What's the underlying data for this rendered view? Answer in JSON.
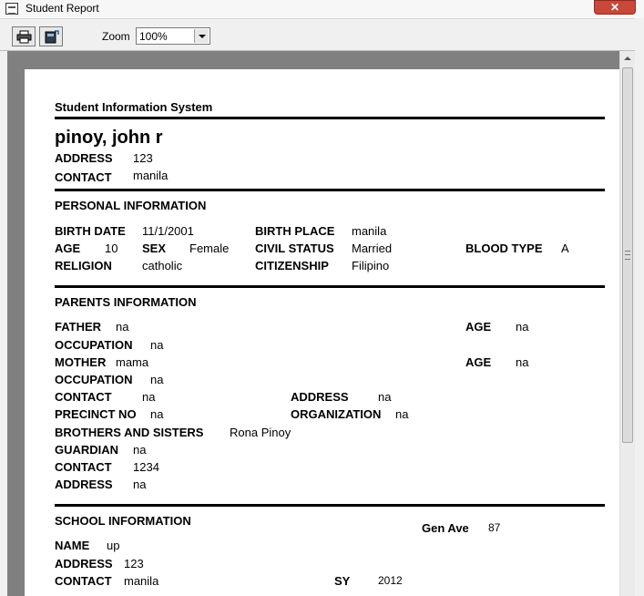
{
  "window": {
    "title": "Student Report",
    "close_glyph": "✕"
  },
  "toolbar": {
    "print_icon": "printer-icon",
    "export_icon": "export-icon",
    "zoom_label": "Zoom",
    "zoom_value": "100%"
  },
  "report": {
    "header": "Student Information System",
    "student_name": "pinoy, john r",
    "address_label": "ADDRESS",
    "address": "123",
    "contact_label": "CONTACT",
    "contact": "manila",
    "personal": {
      "title": "PERSONAL INFORMATION",
      "birth_date_label": "BIRTH DATE",
      "birth_date": "11/1/2001",
      "birth_place_label": "BIRTH PLACE",
      "birth_place": "manila",
      "age_label": "AGE",
      "age": "10",
      "sex_label": "SEX",
      "sex": "Female",
      "civil_status_label": "CIVIL STATUS",
      "civil_status": "Married",
      "blood_type_label": "BLOOD TYPE",
      "blood_type": "A",
      "religion_label": "RELIGION",
      "religion": "catholic",
      "citizenship_label": "CITIZENSHIP",
      "citizenship": "Filipino"
    },
    "parents": {
      "title": "PARENTS INFORMATION",
      "father_label": "FATHER",
      "father": "na",
      "father_age_label": "AGE",
      "father_age": "na",
      "father_occupation_label": "OCCUPATION",
      "father_occupation": "na",
      "mother_label": "MOTHER",
      "mother": "mama",
      "mother_age_label": "AGE",
      "mother_age": "na",
      "mother_occupation_label": "OCCUPATION",
      "mother_occupation": "na",
      "contact_label": "CONTACT",
      "contact": "na",
      "address_label": "ADDRESS",
      "address": "na",
      "precinct_label": "PRECINCT NO",
      "precinct": "na",
      "organization_label": "ORGANIZATION",
      "organization": "na",
      "siblings_label": "BROTHERS AND SISTERS",
      "siblings": "Rona Pinoy",
      "guardian_label": "GUARDIAN",
      "guardian": "na",
      "guardian_contact_label": "CONTACT",
      "guardian_contact": "1234",
      "guardian_address_label": "ADDRESS",
      "guardian_address": "na"
    },
    "school": {
      "title": "SCHOOL INFORMATION",
      "gen_ave_label": "Gen Ave",
      "gen_ave": "87",
      "name_label": "NAME",
      "name": "up",
      "address_label": "ADDRESS",
      "address": "123",
      "contact_label": "CONTACT",
      "contact": "manila",
      "sy_label": "SY",
      "sy": "2012"
    }
  }
}
